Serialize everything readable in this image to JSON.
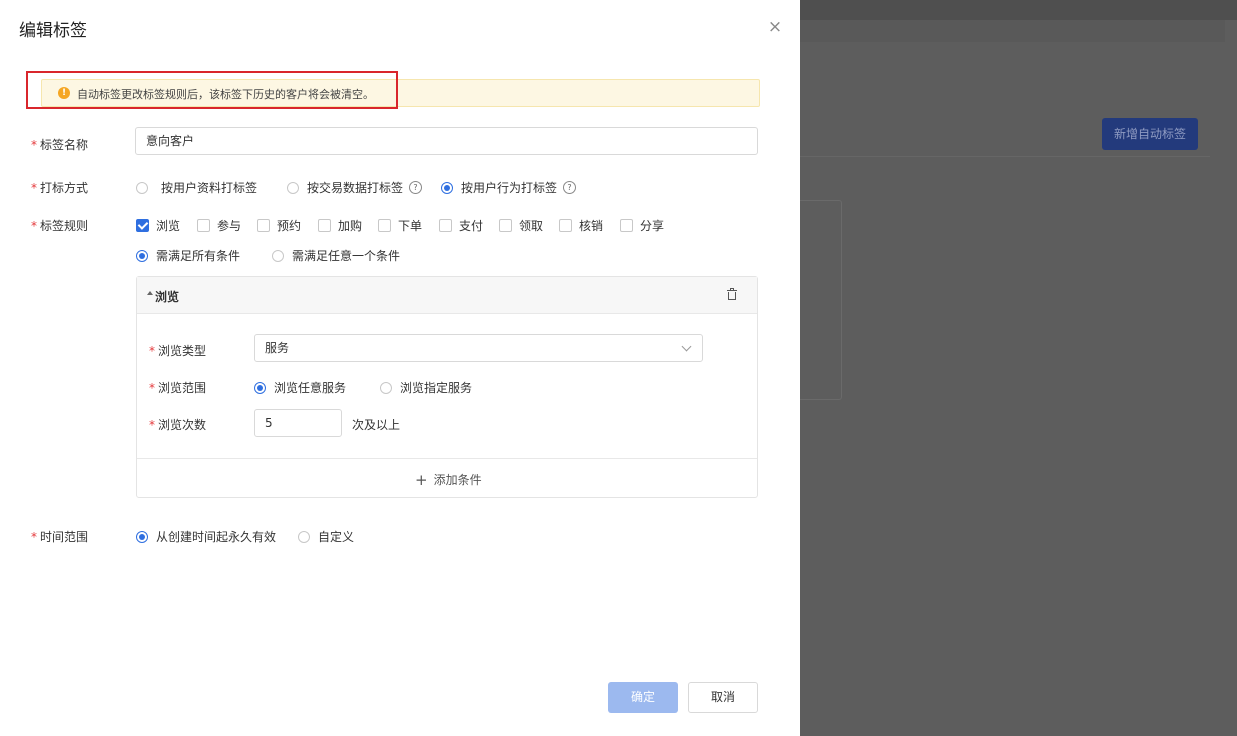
{
  "background": {
    "new_auto_tag_button": "新增自动标签"
  },
  "drawer": {
    "title": "编辑标签",
    "close_symbol": "×"
  },
  "alert": {
    "icon_symbol": "!",
    "text": "自动标签更改标签规则后，该标签下历史的客户将会被清空。"
  },
  "form": {
    "required_mark": "*",
    "tag_name": {
      "label": "标签名称",
      "value": "意向客户"
    },
    "tag_method": {
      "label": "打标方式",
      "options": [
        {
          "label": "按用户资料打标签",
          "checked": false,
          "help": false
        },
        {
          "label": "按交易数据打标签",
          "checked": false,
          "help": true
        },
        {
          "label": "按用户行为打标签",
          "checked": true,
          "help": true
        }
      ],
      "help_symbol": "?"
    },
    "tag_rules": {
      "label": "标签规则",
      "behaviors": [
        {
          "label": "浏览",
          "checked": true
        },
        {
          "label": "参与",
          "checked": false
        },
        {
          "label": "预约",
          "checked": false
        },
        {
          "label": "加购",
          "checked": false
        },
        {
          "label": "下单",
          "checked": false
        },
        {
          "label": "支付",
          "checked": false
        },
        {
          "label": "领取",
          "checked": false
        },
        {
          "label": "核销",
          "checked": false
        },
        {
          "label": "分享",
          "checked": false
        }
      ],
      "match_options": [
        {
          "label": "需满足所有条件",
          "checked": true
        },
        {
          "label": "需满足任意一个条件",
          "checked": false
        }
      ]
    },
    "rule_card": {
      "title": "浏览",
      "browse_type": {
        "label": "浏览类型",
        "value": "服务"
      },
      "browse_scope": {
        "label": "浏览范围",
        "options": [
          {
            "label": "浏览任意服务",
            "checked": true
          },
          {
            "label": "浏览指定服务",
            "checked": false
          }
        ]
      },
      "browse_count": {
        "label": "浏览次数",
        "value": "5",
        "suffix": "次及以上"
      },
      "add_condition": {
        "plus_symbol": "+",
        "label": "添加条件"
      }
    },
    "time_range": {
      "label": "时间范围",
      "options": [
        {
          "label": "从创建时间起永久有效",
          "checked": true
        },
        {
          "label": "自定义",
          "checked": false
        }
      ]
    }
  },
  "footer": {
    "ok_label": "确定",
    "cancel_label": "取消"
  }
}
